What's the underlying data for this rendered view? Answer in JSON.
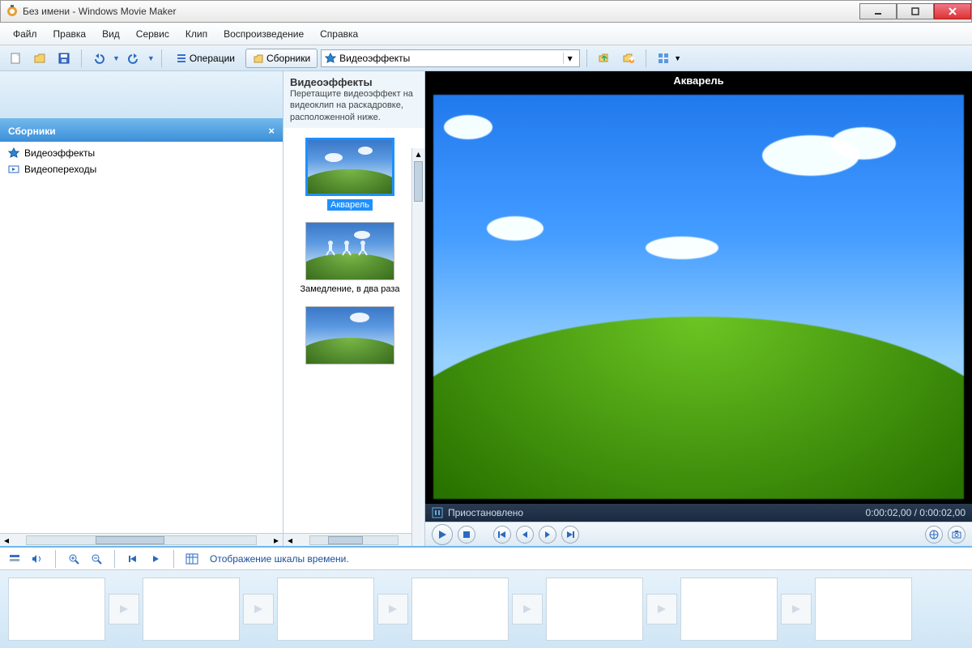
{
  "window": {
    "title": "Без имени - Windows Movie Maker"
  },
  "menu": {
    "file": "Файл",
    "edit": "Правка",
    "view": "Вид",
    "tools": "Сервис",
    "clip": "Клип",
    "play": "Воспроизведение",
    "help": "Справка"
  },
  "toolbar": {
    "operations": "Операции",
    "collections": "Сборники",
    "location": "Видеоэффекты"
  },
  "collections_pane": {
    "header": "Сборники",
    "items": [
      {
        "label": "Видеоэффекты"
      },
      {
        "label": "Видеопереходы"
      }
    ]
  },
  "effects_pane": {
    "title": "Видеоэффекты",
    "subtitle": "Перетащите видеоэффект на видеоклип на раскадровке, расположенной ниже.",
    "items": [
      {
        "label": "Акварель",
        "selected": true
      },
      {
        "label": "Замедление, в два раза",
        "selected": false
      },
      {
        "label": "",
        "selected": false
      }
    ]
  },
  "preview": {
    "title": "Акварель",
    "status": "Приостановлено",
    "time_current": "0:00:02,00",
    "time_total": "0:00:02,00"
  },
  "timeline": {
    "toggle_label": "Отображение шкалы времени."
  }
}
